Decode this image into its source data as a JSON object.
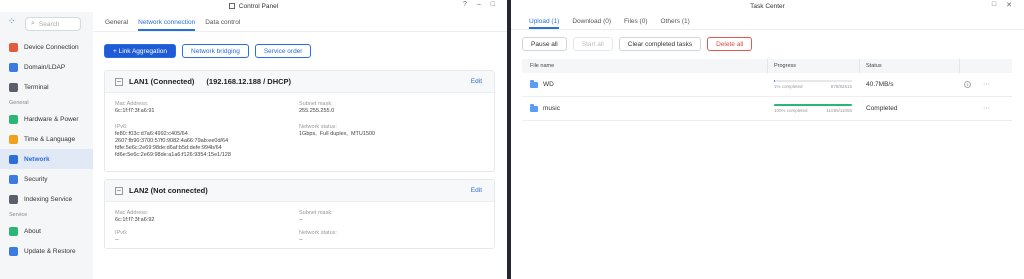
{
  "control_panel": {
    "title": "Control Panel",
    "title_controls": [
      "?",
      "–",
      "□"
    ],
    "search_placeholder": "Search",
    "sidebar": {
      "items_top": [
        {
          "label": "Device Connection",
          "color": "#e25c3c"
        },
        {
          "label": "Domain/LDAP",
          "color": "#3d7be0"
        },
        {
          "label": "Terminal",
          "color": "#5a5f6b"
        }
      ],
      "section_general": "General",
      "items_general": [
        {
          "label": "Hardware & Power",
          "color": "#2bb673"
        },
        {
          "label": "Time & Language",
          "color": "#f0a11f"
        },
        {
          "label": "Network",
          "color": "#2a6fd9",
          "active": true
        },
        {
          "label": "Security",
          "color": "#3d7be0"
        },
        {
          "label": "Indexing Service",
          "color": "#5a5f6b"
        }
      ],
      "section_service": "Service",
      "items_service": [
        {
          "label": "About",
          "color": "#2bb673"
        },
        {
          "label": "Update & Restore",
          "color": "#3d7be0"
        }
      ]
    },
    "tabs": [
      "General",
      "Network connection",
      "Data control"
    ],
    "active_tab": "Network connection",
    "buttons": {
      "link_aggregation": "+ Link Aggregation",
      "network_bridging": "Network bridging",
      "service_order": "Service order"
    },
    "lan1": {
      "title": "LAN1 (Connected)",
      "ip_info": "(192.168.12.188 / DHCP)",
      "edit": "Edit",
      "mac_label": "Mac Address:",
      "mac_value": "6c:1f:f7:3f:a6:91",
      "subnet_label": "Subnet mask:",
      "subnet_value": "255.255.255.0",
      "ipv6_label": "IPv6:",
      "ipv6_value": "fe80::f03c:d7a6:4992:c405/64\n2607:fb90:3700:57f0:9082:4a66:79ab:ee0d/64\nfdfe:5e6c:2e69:98de:d6af:b5d:defe:994b/64\nfd6e:5e6c:2e69:98de:a1a6:f126:9354:15e1/128",
      "status_label": "Network status:",
      "status_value": "1Gbps,  Full duplex,  MTU1500"
    },
    "lan2": {
      "title": "LAN2 (Not connected)",
      "edit": "Edit",
      "mac_label": "Mac Address:",
      "mac_value": "6c:1f:f7:3f:a6:92",
      "subnet_label": "Subnet mask:",
      "subnet_value": "--",
      "ipv6_label": "IPv6:",
      "ipv6_value": "--",
      "status_label": "Network status:",
      "status_value": "--"
    }
  },
  "task_center": {
    "title": "Task Center",
    "title_controls": [
      "□",
      "✕"
    ],
    "tabs": [
      "Upload (1)",
      "Download (0)",
      "Files (0)",
      "Others (1)"
    ],
    "active_tab": "Upload (1)",
    "buttons": {
      "pause_all": "Pause all",
      "start_all": "Start all",
      "clear_completed": "Clear completed tasks",
      "delete_all": "Delete all"
    },
    "columns": {
      "name": "File name",
      "progress": "Progress",
      "status": "Status"
    },
    "rows": [
      {
        "name": "WD",
        "progress_fraction": 0.01,
        "progress_text": "1% completed",
        "progress_count": "879/82515",
        "status": "40.7MB/s",
        "more": "···",
        "pause": "ll"
      },
      {
        "name": "music",
        "progress_fraction": 1.0,
        "progress_text": "100% completed",
        "progress_count": "11055/11055",
        "status": "Completed",
        "more": "···"
      }
    ]
  }
}
